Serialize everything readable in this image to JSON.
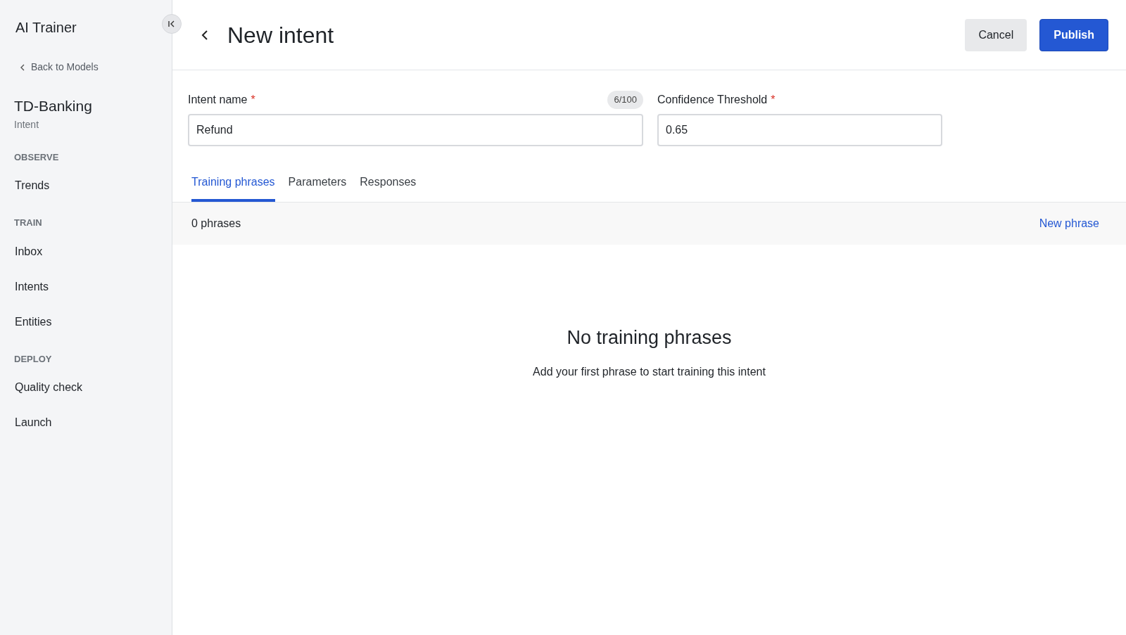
{
  "sidebar": {
    "app_title": "AI Trainer",
    "back_link": "Back to Models",
    "model_name": "TD-Banking",
    "model_subtitle": "Intent",
    "sections": [
      {
        "heading": "OBSERVE",
        "items": [
          {
            "label": "Trends",
            "selected": false
          }
        ]
      },
      {
        "heading": "TRAIN",
        "items": [
          {
            "label": "Inbox",
            "selected": false
          },
          {
            "label": "Intents",
            "selected": false
          },
          {
            "label": "Entities",
            "selected": false
          }
        ]
      },
      {
        "heading": "DEPLOY",
        "items": [
          {
            "label": "Quality check",
            "selected": false
          },
          {
            "label": "Launch",
            "selected": false
          }
        ]
      }
    ]
  },
  "header": {
    "title": "New intent",
    "buttons": [
      {
        "label": "Cancel",
        "kind": "secondary"
      },
      {
        "label": "Publish",
        "kind": "primary"
      }
    ]
  },
  "fields": [
    {
      "label": "Intent name",
      "required_mark": "*",
      "counter": "6/100",
      "value": "Refund"
    },
    {
      "label": "Confidence Threshold",
      "required_mark": "*",
      "value": "0.65"
    }
  ],
  "tabs": [
    {
      "label": "Training phrases",
      "selected": true
    },
    {
      "label": "Parameters",
      "selected": false
    },
    {
      "label": "Responses",
      "selected": false
    }
  ],
  "phrases_bar": {
    "count": "0 phrases",
    "action": "New phrase"
  },
  "empty_state": {
    "title": "No training phrases",
    "message": "Add your first phrase to start training this intent"
  }
}
